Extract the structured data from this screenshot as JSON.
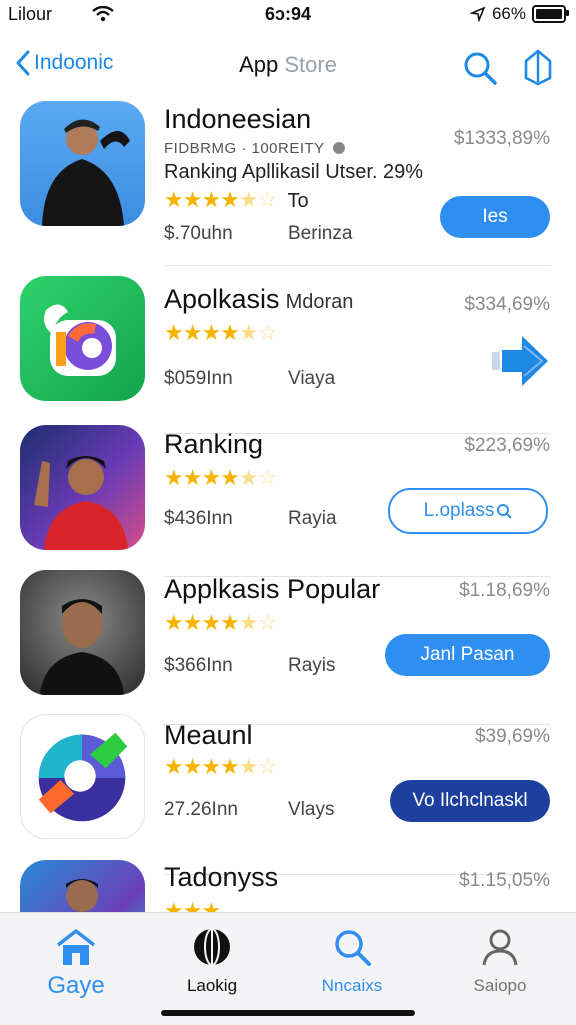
{
  "status": {
    "carrier": "Lilour",
    "time": "6ɔ:94",
    "battery": "66%"
  },
  "nav": {
    "back_label": "Indoonic",
    "title_part1": "App",
    "title_part2": "Store"
  },
  "apps": [
    {
      "name": "Indoneesian",
      "meta": "FIDBRMG · 100REITY",
      "desc": "Ranking Apllikasil Utser. 29%",
      "rating": 4.5,
      "rating_suffix": "To",
      "price": "$1333,89%",
      "size": "$.70uhn",
      "category": "Berinza",
      "action": "Ies",
      "action_style": "fill"
    },
    {
      "name": "Apolkasis",
      "name_sub": "Mdoran",
      "rating": 4.5,
      "price": "$334,69%",
      "size": "$059Inn",
      "category": "Viaya",
      "action_style": "arrow"
    },
    {
      "name": "Ranking",
      "rating": 4.5,
      "price": "$223,69%",
      "size": "$436Inn",
      "category": "Rayia",
      "action": "L.oplass",
      "action_style": "outline"
    },
    {
      "name": "Applkasis Popular",
      "rating": 4.5,
      "price": "$1.18,69%",
      "size": "$366Inn",
      "category": "Rayis",
      "action": "Janl Pasan",
      "action_style": "fill"
    },
    {
      "name": "Meaunl",
      "rating": 4.5,
      "price": "$39,69%",
      "size": "27.26Inn",
      "category": "Vlays",
      "action": "Vo Ilchclnaskl",
      "action_style": "dark"
    },
    {
      "name": "Tadonyss",
      "rating": 3,
      "price": "$1.15,05%"
    }
  ],
  "tabs": [
    {
      "label": "Gaye",
      "icon": "house-icon",
      "color": "#2f8ff0"
    },
    {
      "label": "Laokig",
      "icon": "globe-icon",
      "color": "#111111"
    },
    {
      "label": "Nncaixs",
      "icon": "search-icon",
      "color": "#2f8ff0"
    },
    {
      "label": "Saiopo",
      "icon": "person-icon",
      "color": "#777777"
    }
  ],
  "colors": {
    "accent": "#2f8ff0",
    "star": "#f5b400",
    "dark_button": "#1d3f9e"
  }
}
